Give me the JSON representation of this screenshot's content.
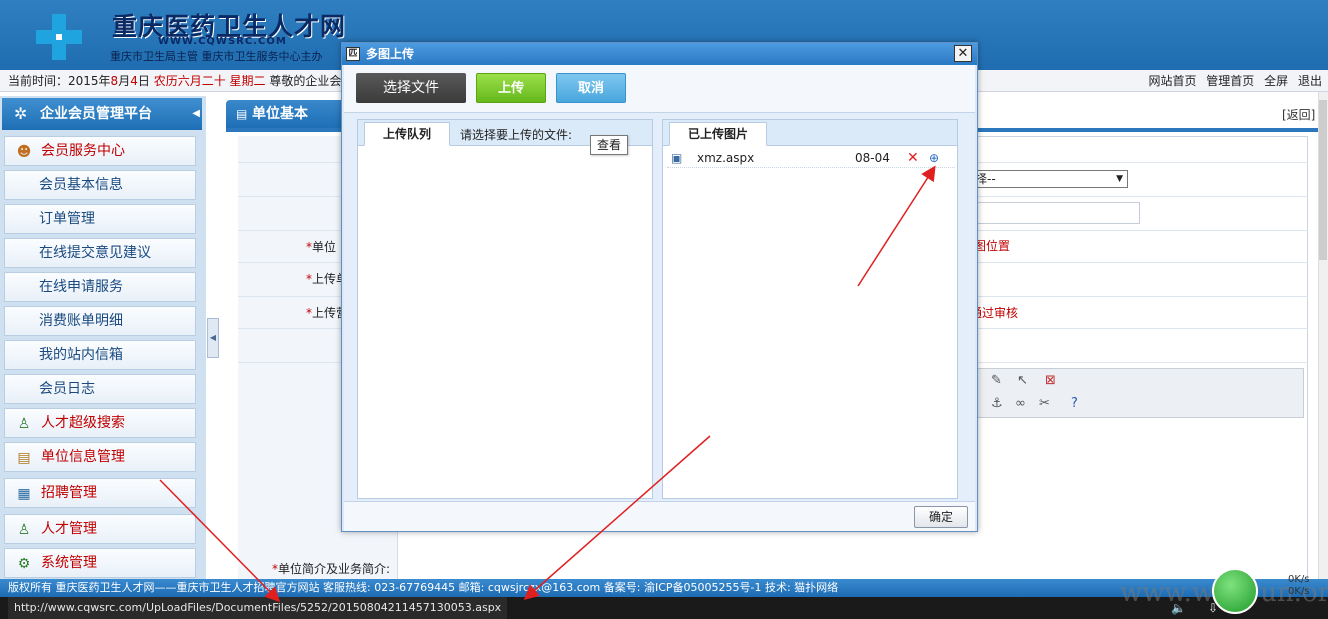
{
  "header": {
    "site_title": "重庆医药卫生人才网",
    "domain": "WWW.CQWSRC.COM",
    "subtitle": "重庆市卫生局主管 重庆市卫生服务中心主办"
  },
  "info_bar": {
    "date_prefix": "当前时间：2015年",
    "month": "8",
    "month_suffix": "月",
    "day": "4",
    "day_suffix": "日",
    "lunar": "农历六月二十",
    "weekday": "星期二",
    "greeting": "尊敬的企业会员",
    "links": [
      "网站首页",
      "管理首页",
      "全屏",
      "退出"
    ]
  },
  "sidebar": {
    "title": "企业会员管理平台",
    "top_item": "会员服务中心",
    "items": [
      "会员基本信息",
      "订单管理",
      "在线提交意见建议",
      "在线申请服务",
      "消费账单明细",
      "我的站内信箱",
      "会员日志"
    ],
    "groups": [
      "人才超级搜索",
      "单位信息管理",
      "招聘管理",
      "人才管理",
      "系统管理"
    ]
  },
  "main": {
    "tab_label": "单位基本",
    "back_link": "[返回]",
    "select_value": "择--",
    "red_note_1": "图位置",
    "red_note_2": "通过审核",
    "labels": [
      "单位",
      "上传单",
      "上传营"
    ],
    "intro_label": "单位简介及业务简介:"
  },
  "dialog": {
    "title": "多图上传",
    "buttons": {
      "select": "选择文件",
      "upload": "上传",
      "cancel": "取消",
      "ok": "确定"
    },
    "queue_tab": "上传队列",
    "queue_hint": "请选择要上传的文件:",
    "uploaded_tab": "已上传图片",
    "files": [
      {
        "name": "xmz.aspx",
        "date": "08-04"
      }
    ],
    "tooltip": "查看"
  },
  "footer": {
    "text": "版权所有 重庆医药卫生人才网——重庆市卫生人才招聘官方网站 客服热线: 023-67769445 邮箱: cqwsjrczx@163.com 备案号: 渝ICP备05005255号-1 技术: 猫扑网络"
  },
  "status_bar": {
    "url": "http://www.cqwsrc.com/UpLoadFiles/DocumentFiles/5252/20150804211457130053.aspx",
    "speed_up": "0K/s",
    "speed_down": "0K/s"
  },
  "watermark": "www.wooyun.org",
  "colors": {
    "header_blue": "#2f7fc1",
    "accent_red": "#c00000",
    "upload_green": "#65b81c",
    "cancel_blue": "#49a6dd",
    "annotation_red": "#e02020"
  }
}
